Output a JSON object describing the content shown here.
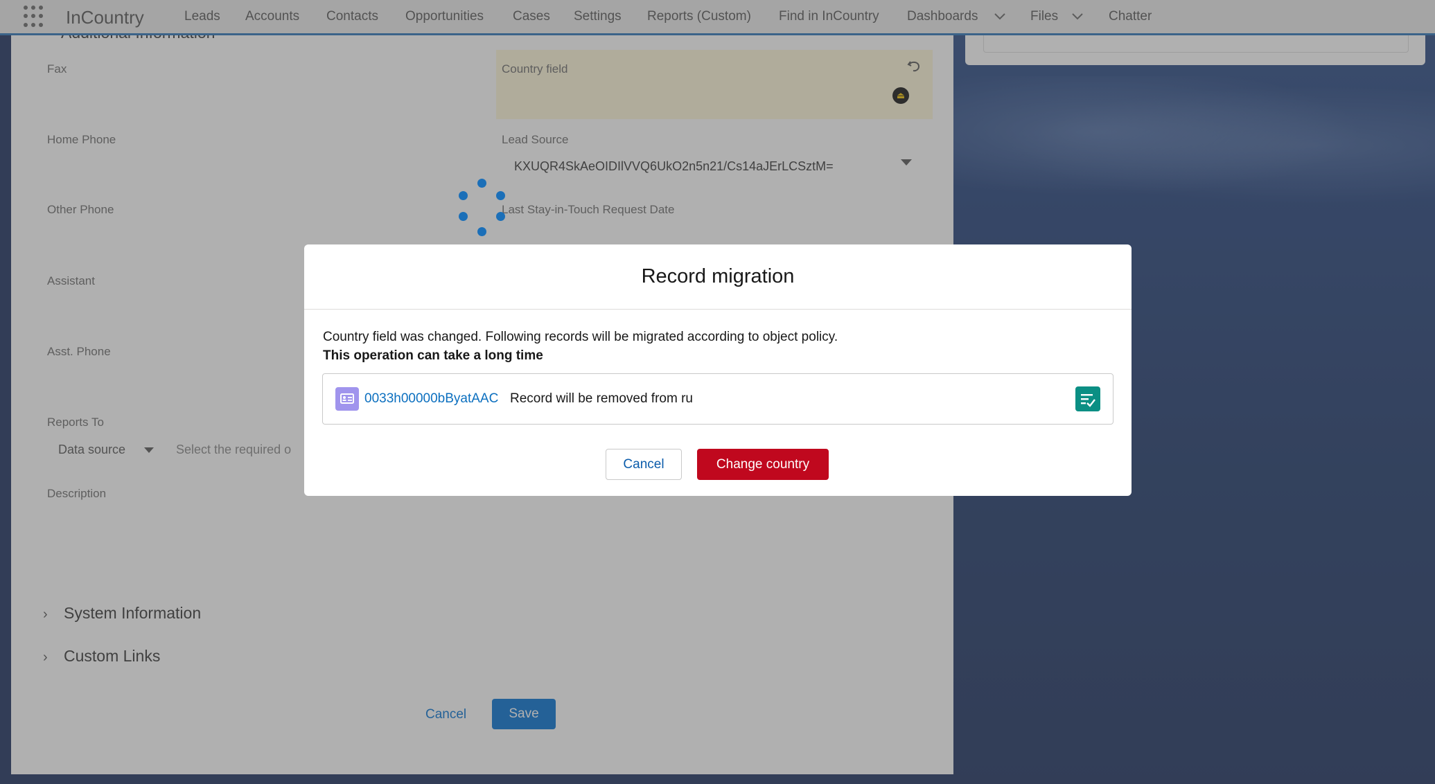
{
  "nav": {
    "app_name": "InCountry",
    "items": [
      "Leads",
      "Accounts",
      "Contacts",
      "Opportunities",
      "Cases",
      "Settings",
      "Reports (Custom)",
      "Find in InCountry",
      "Dashboards",
      "Files",
      "Chatter"
    ]
  },
  "form": {
    "section_header": "Additional Information",
    "fields": {
      "fax": "Fax",
      "country_field": "Country field",
      "home_phone": "Home Phone",
      "lead_source": "Lead Source",
      "lead_source_value": "KXUQR4SkAeOIDIlVVQ6UkO2n5n21/Cs14aJErLCSztM=",
      "other_phone": "Other Phone",
      "last_stay": "Last Stay-in-Touch Request Date",
      "assistant": "Assistant",
      "asst_phone": "Asst. Phone",
      "reports_to": "Reports To",
      "data_source": "Data source",
      "select_required": "Select the required o",
      "description": "Description"
    },
    "sections": [
      "System Information",
      "Custom Links"
    ],
    "cancel_label": "Cancel",
    "save_label": "Save"
  },
  "modal": {
    "title": "Record migration",
    "message": "Country field was changed. Following records will be migrated according to object policy.",
    "warning": "This operation can take a long time",
    "record": {
      "id": "0033h00000bByatAAC",
      "text": "Record will be removed from ru"
    },
    "cancel_label": "Cancel",
    "confirm_label": "Change country"
  }
}
